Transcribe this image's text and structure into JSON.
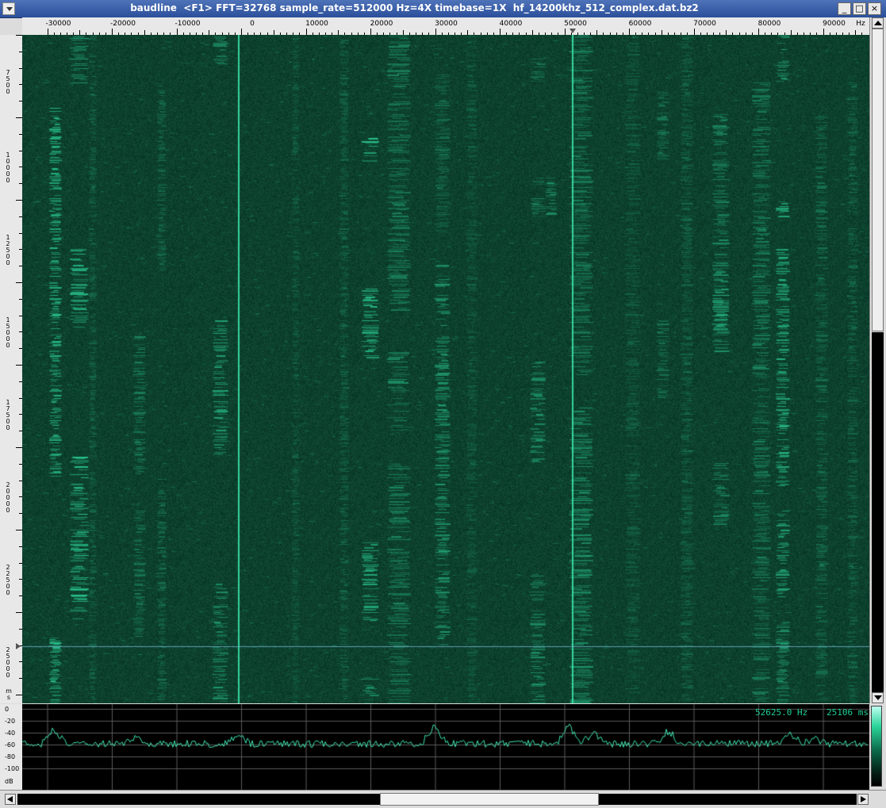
{
  "window": {
    "title": "baudline  <F1> FFT=32768 sample_rate=512000 Hz=4X timebase=1X  hf_14200khz_512_complex.dat.bz2",
    "buttons": [
      "_",
      "□",
      "×"
    ]
  },
  "freq_axis": {
    "ticks": [
      {
        "label": "-30000",
        "value": -30000
      },
      {
        "label": "-20000",
        "value": -20000
      },
      {
        "label": "-10000",
        "value": -10000
      },
      {
        "label": "0",
        "value": 0
      },
      {
        "label": "10000",
        "value": 10000
      },
      {
        "label": "20000",
        "value": 20000
      },
      {
        "label": "30000",
        "value": 30000
      },
      {
        "label": "40000",
        "value": 40000
      },
      {
        "label": "50000",
        "value": 50000
      },
      {
        "label": "60000",
        "value": 60000
      },
      {
        "label": "70000",
        "value": 70000
      },
      {
        "label": "80000",
        "value": 80000
      },
      {
        "label": "90000",
        "value": 90000
      }
    ],
    "unit": "Hz"
  },
  "time_axis": {
    "ticks": [
      "7500",
      "10000",
      "12500",
      "15000",
      "17500",
      "20000",
      "22500",
      "25000"
    ],
    "unit": "ms"
  },
  "spectrum": {
    "db_ticks": [
      "0",
      "-20",
      "-40",
      "-60",
      "-80",
      "-100"
    ],
    "unit": "dB",
    "cursor_freq": "52625.0 Hz",
    "cursor_time": "25106 ms"
  },
  "colors": {
    "background": "#0a3b2c",
    "signal": "#2fe0a4",
    "trace": "#3fe3b0",
    "grid": "#5a5a5a"
  }
}
